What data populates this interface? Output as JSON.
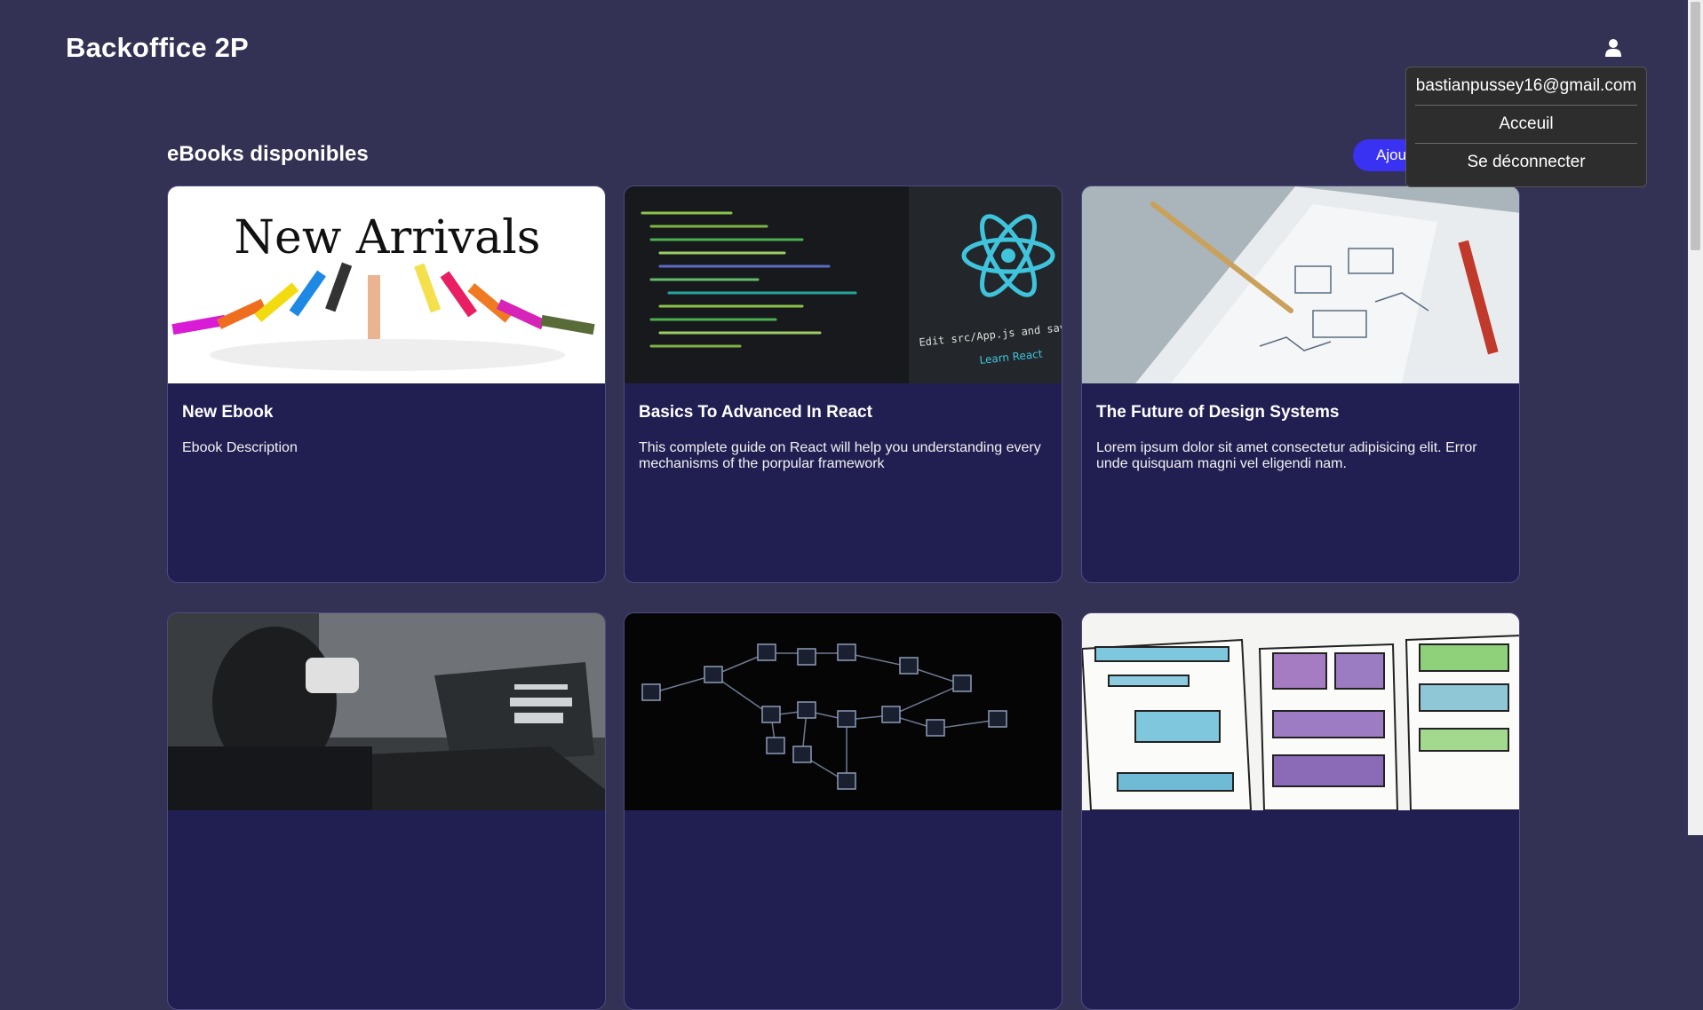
{
  "header": {
    "title": "Backoffice 2P",
    "user_icon": "user-icon"
  },
  "user_menu": {
    "email": "bastianpussey16@gmail.com",
    "items": [
      {
        "label": "Acceuil"
      },
      {
        "label": "Se déconnecter"
      }
    ]
  },
  "main": {
    "section_title": "eBooks disponibles",
    "add_button_label": "Ajou",
    "accent_color": "#3a32f2",
    "ebooks": [
      {
        "title": "New Ebook",
        "description": "Ebook Description",
        "image_text": "New Arrivals"
      },
      {
        "title": "Basics To Advanced In React",
        "description": "This complete guide on React will help you understanding every mechanisms of the porpular framework",
        "image_text_1": "Edit src/App.js and save to rel",
        "image_text_2": "Learn React"
      },
      {
        "title": "The Future of Design Systems",
        "description": "Lorem ipsum dolor sit amet consectetur adipisicing elit. Error unde quisquam magni vel eligendi nam."
      },
      {
        "title": "",
        "description": ""
      },
      {
        "title": "",
        "description": ""
      },
      {
        "title": "",
        "description": ""
      }
    ]
  }
}
